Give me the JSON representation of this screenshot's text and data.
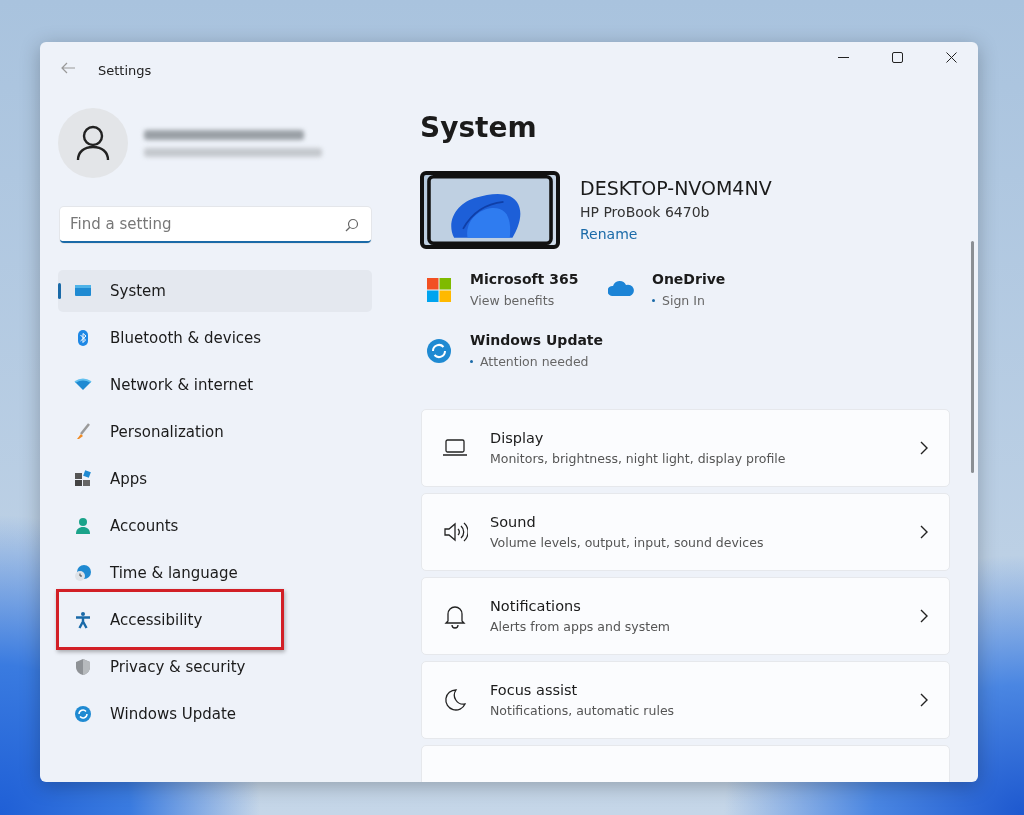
{
  "window": {
    "title": "Settings"
  },
  "search": {
    "placeholder": "Find a setting"
  },
  "nav": [
    {
      "label": "System",
      "selected": true,
      "highlighted": false
    },
    {
      "label": "Bluetooth & devices",
      "selected": false,
      "highlighted": false
    },
    {
      "label": "Network & internet",
      "selected": false,
      "highlighted": false
    },
    {
      "label": "Personalization",
      "selected": false,
      "highlighted": false
    },
    {
      "label": "Apps",
      "selected": false,
      "highlighted": false
    },
    {
      "label": "Accounts",
      "selected": false,
      "highlighted": false
    },
    {
      "label": "Time & language",
      "selected": false,
      "highlighted": false
    },
    {
      "label": "Accessibility",
      "selected": false,
      "highlighted": true
    },
    {
      "label": "Privacy & security",
      "selected": false,
      "highlighted": false
    },
    {
      "label": "Windows Update",
      "selected": false,
      "highlighted": false
    }
  ],
  "page_title": "System",
  "device": {
    "name": "DESKTOP-NVOM4NV",
    "model": "HP ProBook 6470b",
    "rename": "Rename"
  },
  "quick_links": [
    [
      {
        "title": "Microsoft 365",
        "subtitle": "View benefits",
        "dot": false
      },
      {
        "title": "OneDrive",
        "subtitle": "Sign In",
        "dot": true
      }
    ],
    [
      {
        "title": "Windows Update",
        "subtitle": "Attention needed",
        "dot": true
      }
    ]
  ],
  "cards": [
    {
      "title": "Display",
      "description": "Monitors, brightness, night light, display profile"
    },
    {
      "title": "Sound",
      "description": "Volume levels, output, input, sound devices"
    },
    {
      "title": "Notifications",
      "description": "Alerts from apps and system"
    },
    {
      "title": "Focus assist",
      "description": "Notifications, automatic rules"
    }
  ]
}
